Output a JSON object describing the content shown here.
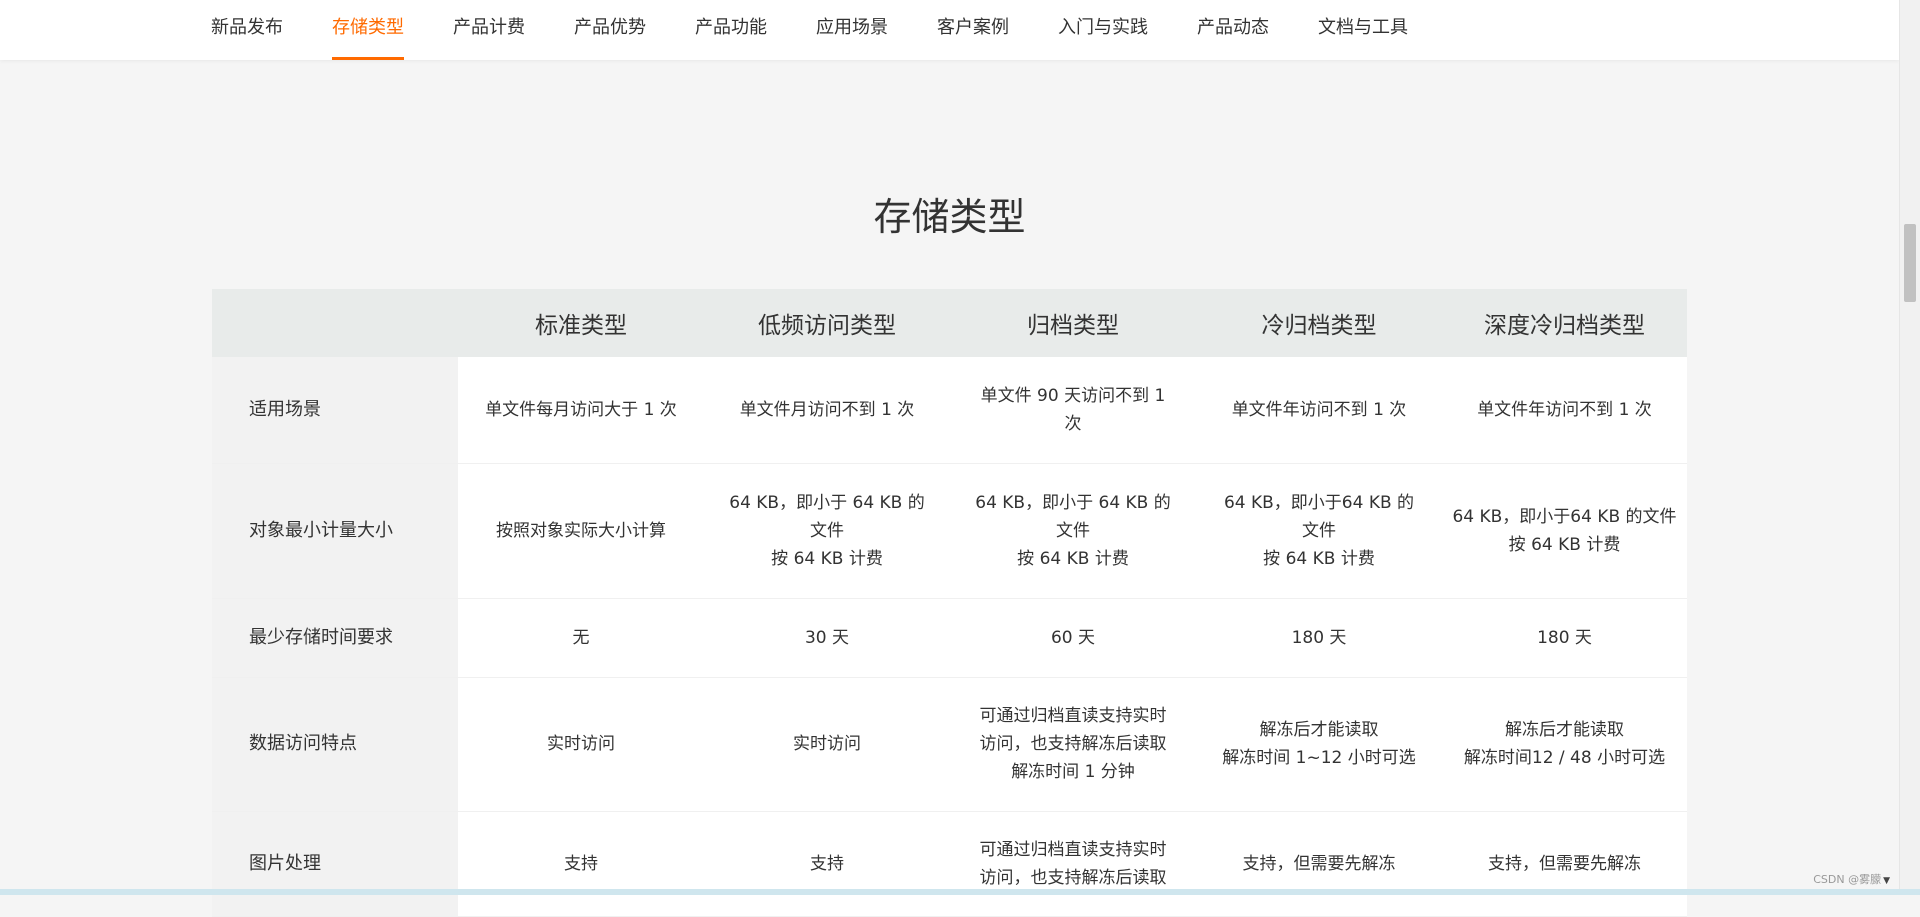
{
  "nav": {
    "items": [
      {
        "label": "新品发布",
        "active": false
      },
      {
        "label": "存储类型",
        "active": true
      },
      {
        "label": "产品计费",
        "active": false
      },
      {
        "label": "产品优势",
        "active": false
      },
      {
        "label": "产品功能",
        "active": false
      },
      {
        "label": "应用场景",
        "active": false
      },
      {
        "label": "客户案例",
        "active": false
      },
      {
        "label": "入门与实践",
        "active": false
      },
      {
        "label": "产品动态",
        "active": false
      },
      {
        "label": "文档与工具",
        "active": false
      }
    ],
    "accent_color": "#ff6a00"
  },
  "section": {
    "title": "存储类型"
  },
  "table": {
    "headers": [
      "",
      "标准类型",
      "低频访问类型",
      "归档类型",
      "冷归档类型",
      "深度冷归档类型"
    ],
    "rows": [
      {
        "label": "适用场景",
        "cells": [
          [
            "单文件每月访问大于 1 次"
          ],
          [
            "单文件月访问不到 1 次"
          ],
          [
            "单文件 90 天访问不到 1",
            "次"
          ],
          [
            "单文件年访问不到 1 次"
          ],
          [
            "单文件年访问不到 1 次"
          ]
        ]
      },
      {
        "label": "对象最小计量大小",
        "cells": [
          [
            "按照对象实际大小计算"
          ],
          [
            "64 KB，即小于 64 KB 的",
            "文件",
            "按 64 KB 计费"
          ],
          [
            "64 KB，即小于 64 KB 的",
            "文件",
            "按 64 KB 计费"
          ],
          [
            "64 KB，即小于64 KB 的",
            "文件",
            "按 64 KB 计费"
          ],
          [
            "64 KB，即小于64 KB 的文件",
            "按 64 KB 计费"
          ]
        ]
      },
      {
        "label": "最少存储时间要求",
        "cells": [
          [
            "无"
          ],
          [
            "30 天"
          ],
          [
            "60 天"
          ],
          [
            "180 天"
          ],
          [
            "180 天"
          ]
        ]
      },
      {
        "label": "数据访问特点",
        "cells": [
          [
            "实时访问"
          ],
          [
            "实时访问"
          ],
          [
            "可通过归档直读支持实时",
            "访问，也支持解冻后读取",
            "解冻时间 1 分钟"
          ],
          [
            "解冻后才能读取",
            "解冻时间 1~12 小时可选"
          ],
          [
            "解冻后才能读取",
            "解冻时间12 / 48 小时可选"
          ]
        ]
      },
      {
        "label": "图片处理",
        "cells": [
          [
            "支持"
          ],
          [
            "支持"
          ],
          [
            "可通过归档直读支持实时",
            "访问，也支持解冻后读取"
          ],
          [
            "支持，但需要先解冻"
          ],
          [
            "支持，但需要先解冻"
          ]
        ]
      }
    ]
  },
  "watermark": {
    "text": "CSDN @雾朦"
  }
}
